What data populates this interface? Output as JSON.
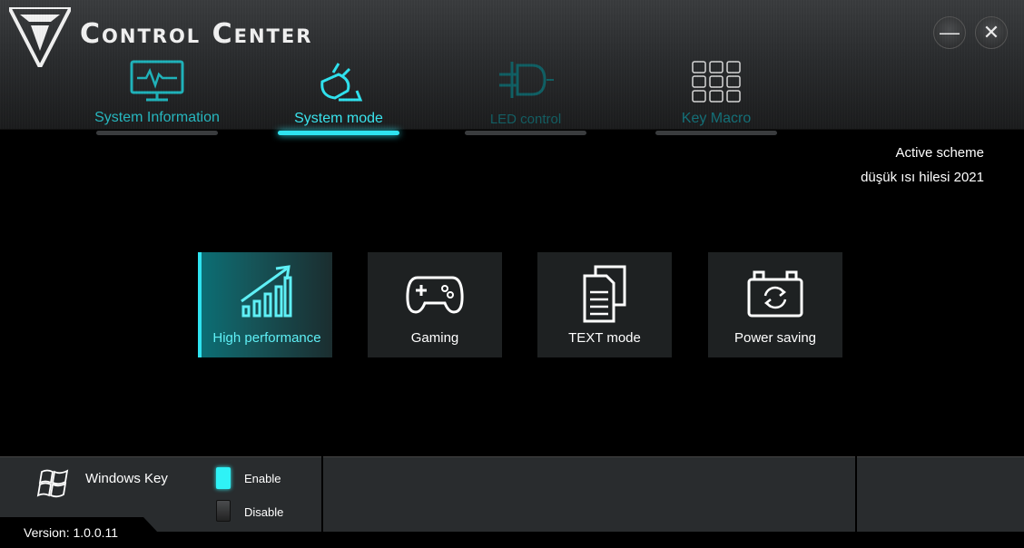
{
  "app": {
    "title": "Control Center"
  },
  "window": {
    "minimize": "—",
    "close": "✕"
  },
  "tabs": [
    {
      "label": "System Information",
      "icon": "monitor-pulse-icon",
      "active": false
    },
    {
      "label": "System mode",
      "icon": "mode-plug-icon",
      "active": true
    },
    {
      "label": "LED control",
      "icon": "led-bulb-icon",
      "active": false
    },
    {
      "label": "Key Macro",
      "icon": "keypad-icon",
      "active": false
    }
  ],
  "scheme": {
    "label": "Active scheme",
    "value": "düşük ısı hilesi 2021"
  },
  "modes": [
    {
      "label": "High performance",
      "icon": "performance-bars-icon",
      "active": true
    },
    {
      "label": "Gaming",
      "icon": "gamepad-icon",
      "active": false
    },
    {
      "label": "TEXT mode",
      "icon": "document-icon",
      "active": false
    },
    {
      "label": "Power saving",
      "icon": "battery-cycle-icon",
      "active": false
    }
  ],
  "windows_key": {
    "label": "Windows Key",
    "enable": "Enable",
    "disable": "Disable",
    "enabled": true
  },
  "version": "Version: 1.0.0.11",
  "colors": {
    "accent": "#2fe3f0",
    "card": "#1e2122",
    "panel": "#292c2e"
  }
}
